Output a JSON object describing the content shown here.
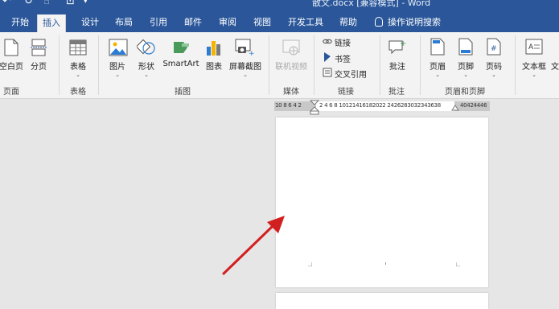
{
  "titlebar": {
    "title": "散文.docx [兼容模式] - Word"
  },
  "tabs": [
    "开始",
    "插入",
    "设计",
    "布局",
    "引用",
    "邮件",
    "审阅",
    "视图",
    "开发工具",
    "帮助"
  ],
  "active_tab": "插入",
  "tell_me": "操作说明搜索",
  "ribbon": {
    "pages": {
      "blank_label": "空白页",
      "break_label": "分页",
      "group": "页面"
    },
    "tables": {
      "table_label": "表格",
      "group": "表格"
    },
    "illustrations": {
      "picture_label": "图片",
      "shapes_label": "形状",
      "smartart_label": "SmartArt",
      "chart_label": "图表",
      "screenshot_label": "屏幕截图",
      "group": "插图"
    },
    "media": {
      "online_video_label": "联机视频",
      "group": "媒体"
    },
    "links": {
      "link_label": "链接",
      "bookmark_label": "书签",
      "crossref_label": "交叉引用",
      "group": "链接"
    },
    "comments": {
      "comment_label": "批注",
      "group": "批注"
    },
    "header_footer": {
      "header_label": "页眉",
      "footer_label": "页脚",
      "pagenum_label": "页码",
      "group": "页眉和页脚"
    },
    "text": {
      "textbox_label": "文本框",
      "more_label": "文"
    }
  },
  "ruler": {
    "left_text": "10 8 6 4 2",
    "right_text": "2 4 6 8 10121416182022 2426283032343638",
    "far_text": "40424446"
  },
  "colors": {
    "word_blue": "#2b579a",
    "ribbon_bg": "#f3f3f3",
    "canvas_bg": "#e6e6e6",
    "arrow": "#d21f1f"
  }
}
